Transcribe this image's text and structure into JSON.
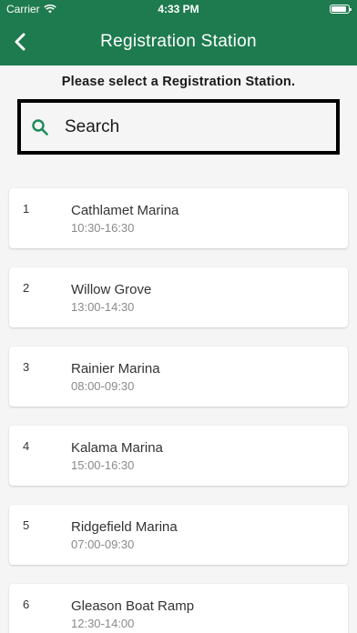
{
  "status_bar": {
    "carrier": "Carrier",
    "time": "4:33 PM",
    "battery_level": 0.9
  },
  "header": {
    "title": "Registration Station",
    "back_icon": "chevron-left-icon"
  },
  "instruction": "Please select a Registration Station.",
  "search": {
    "placeholder": "Search",
    "value": "",
    "icon": "search-icon"
  },
  "stations": [
    {
      "number": "1",
      "name": "Cathlamet Marina",
      "time": "10:30-16:30"
    },
    {
      "number": "2",
      "name": "Willow Grove",
      "time": "13:00-14:30"
    },
    {
      "number": "3",
      "name": "Rainier Marina",
      "time": "08:00-09:30"
    },
    {
      "number": "4",
      "name": "Kalama Marina",
      "time": "15:00-16:30"
    },
    {
      "number": "5",
      "name": "Ridgefield Marina",
      "time": "07:00-09:30"
    },
    {
      "number": "6",
      "name": "Gleason Boat Ramp",
      "time": "12:30-14:00"
    }
  ],
  "colors": {
    "primary": "#1e7b4f",
    "search_icon": "#1e8a5a",
    "background": "#f5f5f5"
  }
}
